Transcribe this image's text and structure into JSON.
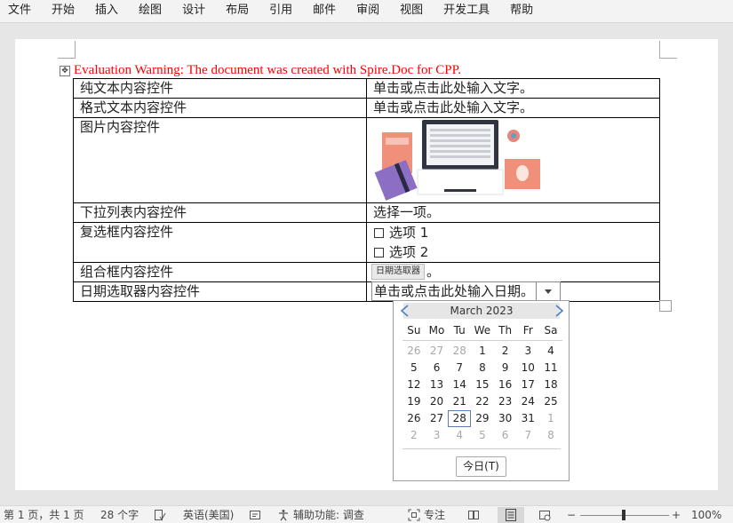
{
  "menu": [
    "文件",
    "开始",
    "插入",
    "绘图",
    "设计",
    "布局",
    "引用",
    "邮件",
    "审阅",
    "视图",
    "开发工具",
    "帮助"
  ],
  "document": {
    "warning": "Evaluation Warning: The document was created with Spire.Doc for CPP.",
    "rows": {
      "plain_text": {
        "label": "纯文本内容控件",
        "value": "单击或点击此处输入文字。"
      },
      "rich_text": {
        "label": "格式文本内容控件",
        "value": "单击或点击此处输入文字。"
      },
      "picture": {
        "label": "图片内容控件"
      },
      "dropdown": {
        "label": "下拉列表内容控件",
        "value": "选择一项。"
      },
      "checkbox": {
        "label": "复选框内容控件",
        "options": [
          "选项 1",
          "选项 2"
        ]
      },
      "combo": {
        "label": "组合框内容控件",
        "tag": "日期选取器",
        "suffix": "。"
      },
      "date": {
        "label": "日期选取器内容控件",
        "value": "单击或点击此处输入日期。"
      }
    }
  },
  "calendar": {
    "month": "March 2023",
    "weekdays": [
      "Su",
      "Mo",
      "Tu",
      "We",
      "Th",
      "Fr",
      "Sa"
    ],
    "weeks": [
      [
        "26",
        "27",
        "28",
        "1",
        "2",
        "3",
        "4"
      ],
      [
        "5",
        "6",
        "7",
        "8",
        "9",
        "10",
        "11"
      ],
      [
        "12",
        "13",
        "14",
        "15",
        "16",
        "17",
        "18"
      ],
      [
        "19",
        "20",
        "21",
        "22",
        "23",
        "24",
        "25"
      ],
      [
        "26",
        "27",
        "28",
        "29",
        "30",
        "31",
        "1"
      ],
      [
        "2",
        "3",
        "4",
        "5",
        "6",
        "7",
        "8"
      ]
    ],
    "selected": "28",
    "today_label": "今日(T)"
  },
  "status": {
    "page": "第 1 页，共 1 页",
    "words": "28 个字",
    "language": "英语(美国)",
    "accessibility": "辅助功能: 调查",
    "focus": "专注",
    "zoom": "100%"
  },
  "colors": {
    "warning": "#ff0000",
    "accent": "#4a7fc1"
  }
}
